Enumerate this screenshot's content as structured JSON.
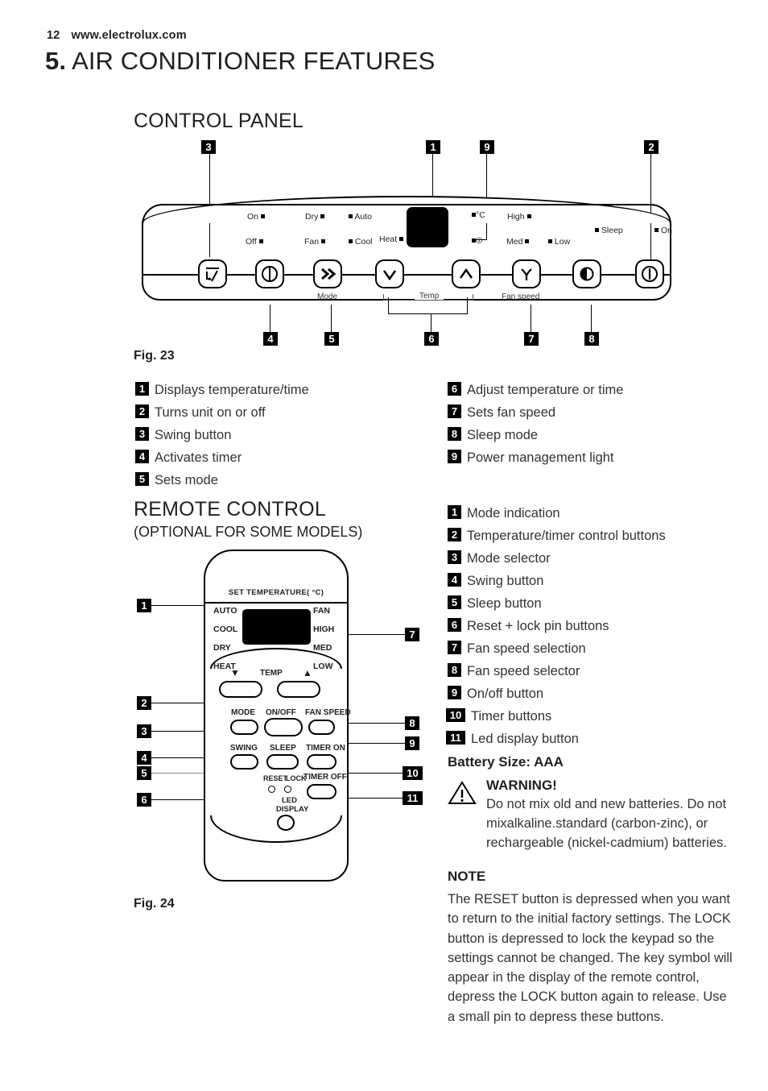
{
  "header": {
    "page_number": "12",
    "website": "www.electrolux.com"
  },
  "chapter": {
    "number": "5.",
    "title": "AIR CONDITIONER FEATURES"
  },
  "sections": {
    "control_panel_heading": "CONTROL PANEL",
    "remote_heading": "REMOTE CONTROL",
    "remote_subheading": "(OPTIONAL FOR SOME MODELS)",
    "fig23_caption": "Fig. 23",
    "fig24_caption": "Fig. 24"
  },
  "control_panel": {
    "indicators": {
      "on": "On",
      "off": "Off",
      "dry": "Dry",
      "fan": "Fan",
      "auto": "Auto",
      "cool": "Cool",
      "heat": "Heat",
      "celsius": "°C",
      "high": "High",
      "med": "Med",
      "low": "Low",
      "sleep": "Sleep",
      "power_on": "On"
    },
    "sublabels": {
      "mode": "Mode",
      "temp": "Temp",
      "fan_speed": "Fan speed"
    },
    "buttons": [
      {
        "name": "swing-button",
        "icon": "swing-icon",
        "callout": "3"
      },
      {
        "name": "timer-button",
        "icon": "timer-clock-icon",
        "callout": "4"
      },
      {
        "name": "mode-button",
        "icon": "double-chevron-right-icon",
        "callout": "5"
      },
      {
        "name": "temp-down-button",
        "icon": "chevron-down-icon",
        "callout": "6"
      },
      {
        "name": "temp-up-button",
        "icon": "chevron-up-icon",
        "callout": "6"
      },
      {
        "name": "fan-speed-button",
        "icon": "fan-icon",
        "callout": "7"
      },
      {
        "name": "sleep-button",
        "icon": "moon-icon",
        "callout": "8"
      },
      {
        "name": "power-button",
        "icon": "power-icon",
        "callout": "2"
      }
    ],
    "callouts_top": [
      "3",
      "1",
      "9",
      "2"
    ],
    "callouts_bottom": [
      "4",
      "5",
      "6",
      "7",
      "8"
    ]
  },
  "fig23_legend": {
    "left": [
      {
        "num": "1",
        "text": "Displays temperature/time"
      },
      {
        "num": "2",
        "text": "Turns unit on or off"
      },
      {
        "num": "3",
        "text": "Swing button"
      },
      {
        "num": "4",
        "text": "Activates timer"
      },
      {
        "num": "5",
        "text": "Sets mode"
      }
    ],
    "right": [
      {
        "num": "6",
        "text": "Adjust temperature or time"
      },
      {
        "num": "7",
        "text": "Sets fan speed"
      },
      {
        "num": "8",
        "text": "Sleep mode"
      },
      {
        "num": "9",
        "text": "Power management light"
      }
    ]
  },
  "remote": {
    "set_temperature_label": "SET TEMPERATURE( °C)",
    "modes_left": [
      "AUTO",
      "COOL",
      "DRY",
      "HEAT"
    ],
    "modes_right": [
      "FAN",
      "HIGH",
      "MED",
      "LOW"
    ],
    "temp_label": "TEMP",
    "temp_down_glyph": "▼",
    "temp_up_glyph": "▲",
    "buttons": {
      "mode": "MODE",
      "on_off": "ON/OFF",
      "fan_speed": "FAN SPEED",
      "swing": "SWING",
      "sleep": "SLEEP",
      "timer_on": "TIMER ON",
      "timer_off": "TIMER OFF",
      "reset": "RESET",
      "lock": "LOCK",
      "led_display_line1": "LED",
      "led_display_line2": "DISPLAY"
    },
    "callouts_left": [
      "1",
      "2",
      "3",
      "4",
      "5",
      "6"
    ],
    "callouts_right": [
      "7",
      "8",
      "9",
      "10",
      "11"
    ]
  },
  "fig24_legend": [
    {
      "num": "1",
      "text": "Mode indication"
    },
    {
      "num": "2",
      "text": "Temperature/timer control buttons"
    },
    {
      "num": "3",
      "text": "Mode selector"
    },
    {
      "num": "4",
      "text": "Swing button"
    },
    {
      "num": "5",
      "text": "Sleep button"
    },
    {
      "num": "6",
      "text": "Reset + lock pin buttons"
    },
    {
      "num": "7",
      "text": "Fan speed selection"
    },
    {
      "num": "8",
      "text": "Fan speed selector"
    },
    {
      "num": "9",
      "text": "On/off button"
    },
    {
      "num": "10",
      "text": "Timer buttons"
    },
    {
      "num": "11",
      "text": "Led display button"
    }
  ],
  "battery": {
    "size_label": "Battery Size: AAA",
    "warning_title": "WARNING!",
    "warning_body": "Do not mix old and new batteries. Do not mixalkaline.standard (carbon-zinc), or rechargeable (nickel-cadmium) batteries."
  },
  "note": {
    "title": "NOTE",
    "body": "The RESET button is depressed when you want to return to the initial factory settings. The LOCK button is depressed to lock the keypad so the settings cannot be changed. The key symbol will appear in the display of the remote control, depress the LOCK button again to release. Use a small pin to depress these buttons."
  },
  "colors": {
    "ink": "#221f1f",
    "body_text": "#333333",
    "chip_bg": "#000000"
  }
}
